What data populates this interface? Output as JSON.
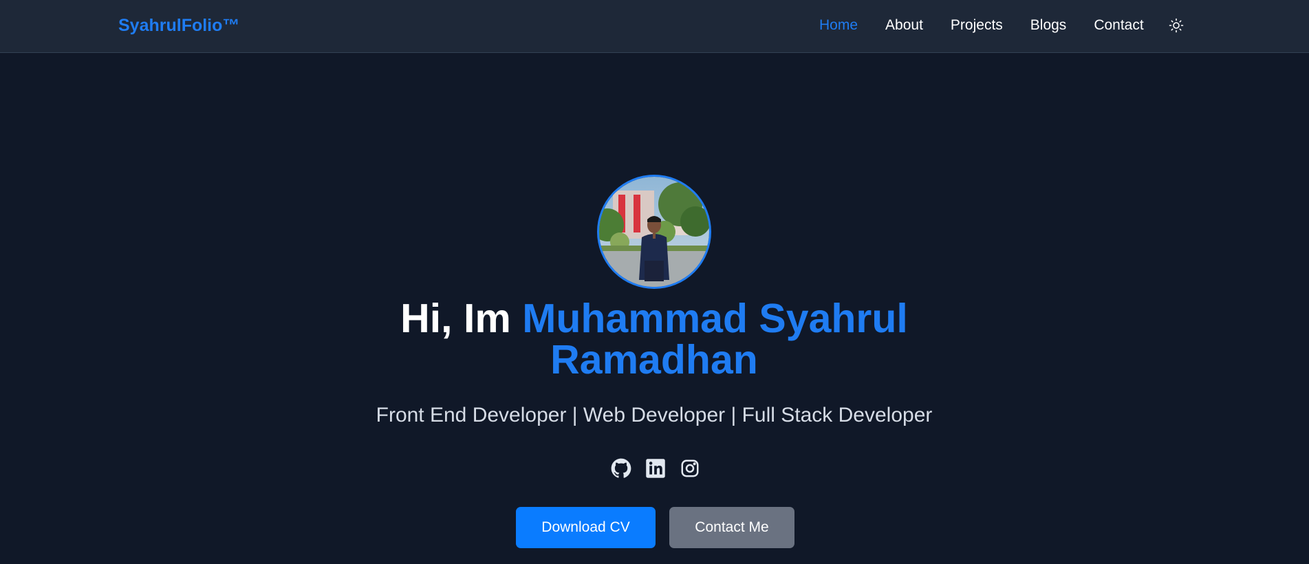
{
  "navbar": {
    "brand": "SyahrulFolio™",
    "links": [
      {
        "label": "Home",
        "active": true
      },
      {
        "label": "About",
        "active": false
      },
      {
        "label": "Projects",
        "active": false
      },
      {
        "label": "Blogs",
        "active": false
      },
      {
        "label": "Contact",
        "active": false
      }
    ],
    "theme_toggle_icon": "sun-icon"
  },
  "hero": {
    "avatar_icon": "profile-photo",
    "greeting": "Hi, Im ",
    "name_line1": "Muhammad Syahrul",
    "name_line2": "Ramadhan",
    "subtitle": "Front End Developer | Web Developer | Full Stack Developer",
    "socials": [
      "github-icon",
      "linkedin-icon",
      "instagram-icon"
    ],
    "buttons": {
      "primary": "Download CV",
      "secondary": "Contact Me"
    }
  },
  "colors": {
    "background": "#101828",
    "navbar": "#1e2838",
    "accent": "#1f7cf2",
    "primary_button": "#0a7cff",
    "secondary_button": "#6a7281"
  }
}
